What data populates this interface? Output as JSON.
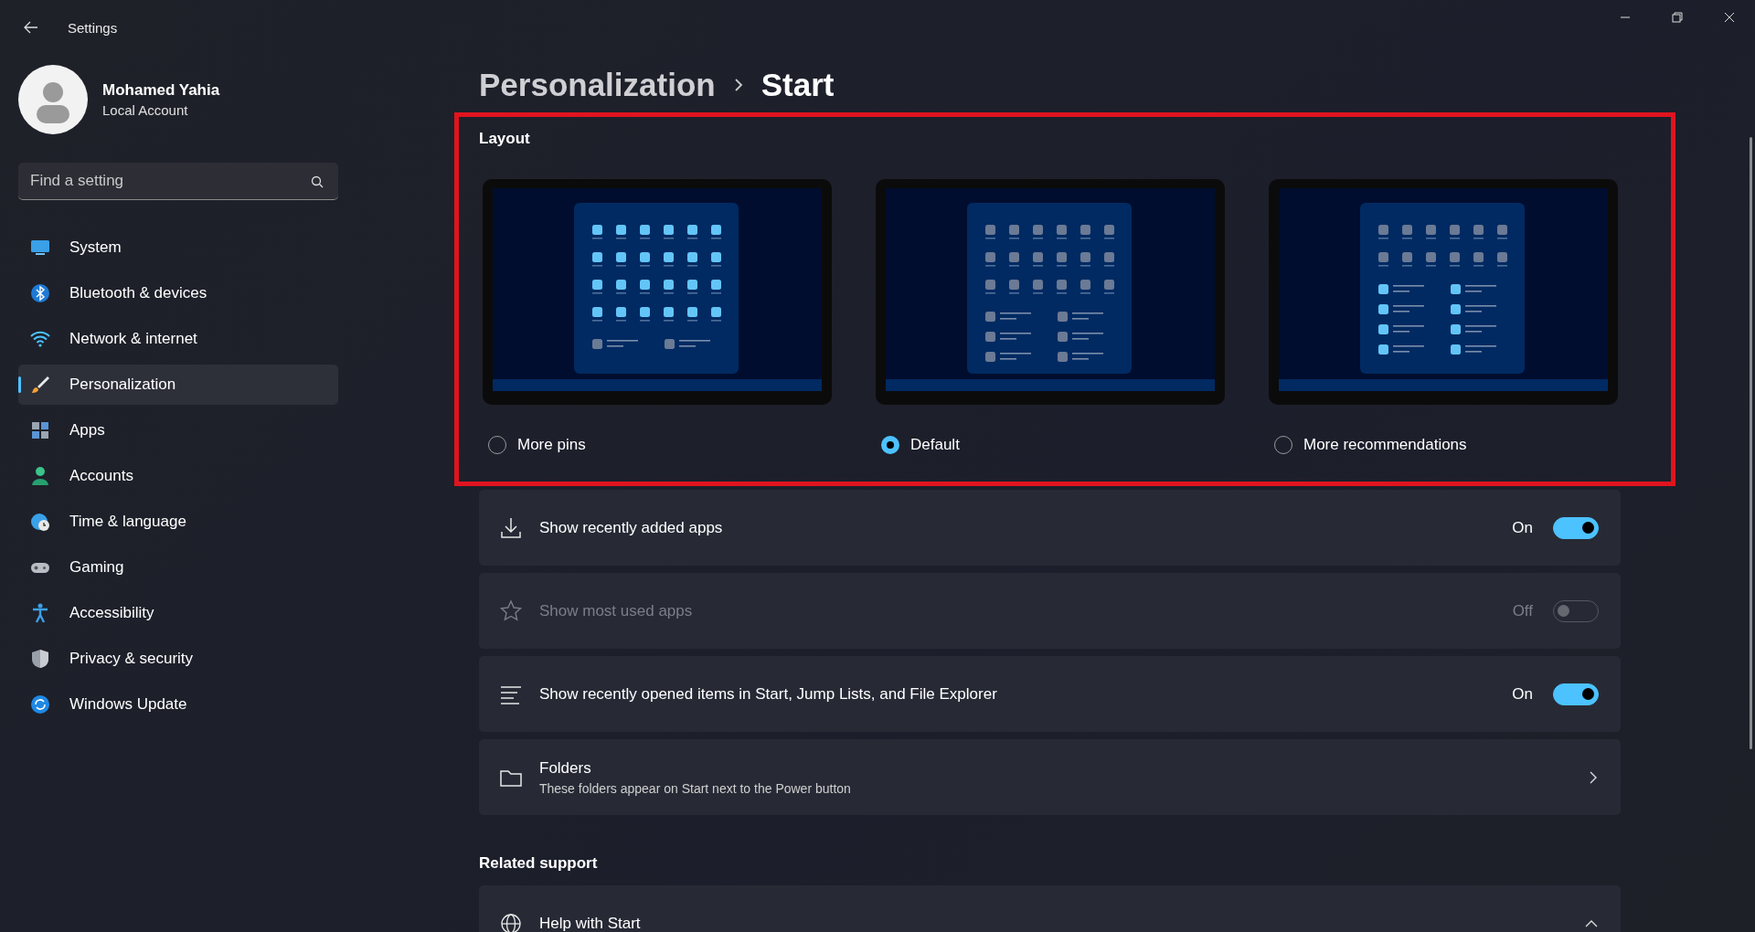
{
  "window": {
    "title": "Settings"
  },
  "account": {
    "name": "Mohamed Yahia",
    "type": "Local Account"
  },
  "search": {
    "placeholder": "Find a setting"
  },
  "sidebar": {
    "items": [
      {
        "label": "System",
        "selected": false
      },
      {
        "label": "Bluetooth & devices",
        "selected": false
      },
      {
        "label": "Network & internet",
        "selected": false
      },
      {
        "label": "Personalization",
        "selected": true
      },
      {
        "label": "Apps",
        "selected": false
      },
      {
        "label": "Accounts",
        "selected": false
      },
      {
        "label": "Time & language",
        "selected": false
      },
      {
        "label": "Gaming",
        "selected": false
      },
      {
        "label": "Accessibility",
        "selected": false
      },
      {
        "label": "Privacy & security",
        "selected": false
      },
      {
        "label": "Windows Update",
        "selected": false
      }
    ]
  },
  "breadcrumb": {
    "parent": "Personalization",
    "current": "Start"
  },
  "layout": {
    "title": "Layout",
    "options": [
      {
        "label": "More pins",
        "kind": "more_pins",
        "selected": false
      },
      {
        "label": "Default",
        "kind": "default",
        "selected": true
      },
      {
        "label": "More recommendations",
        "kind": "more_recommendations",
        "selected": false
      }
    ]
  },
  "settings": [
    {
      "kind": "toggle",
      "label": "Show recently added apps",
      "state_text": "On",
      "on": true,
      "disabled": false
    },
    {
      "kind": "toggle",
      "label": "Show most used apps",
      "state_text": "Off",
      "on": false,
      "disabled": true
    },
    {
      "kind": "toggle",
      "label": "Show recently opened items in Start, Jump Lists, and File Explorer",
      "state_text": "On",
      "on": true,
      "disabled": false
    },
    {
      "kind": "link",
      "label": "Folders",
      "description": "These folders appear on Start next to the Power button"
    }
  ],
  "related_support": {
    "title": "Related support",
    "items": [
      {
        "label": "Help with Start",
        "expanded": true
      }
    ]
  }
}
